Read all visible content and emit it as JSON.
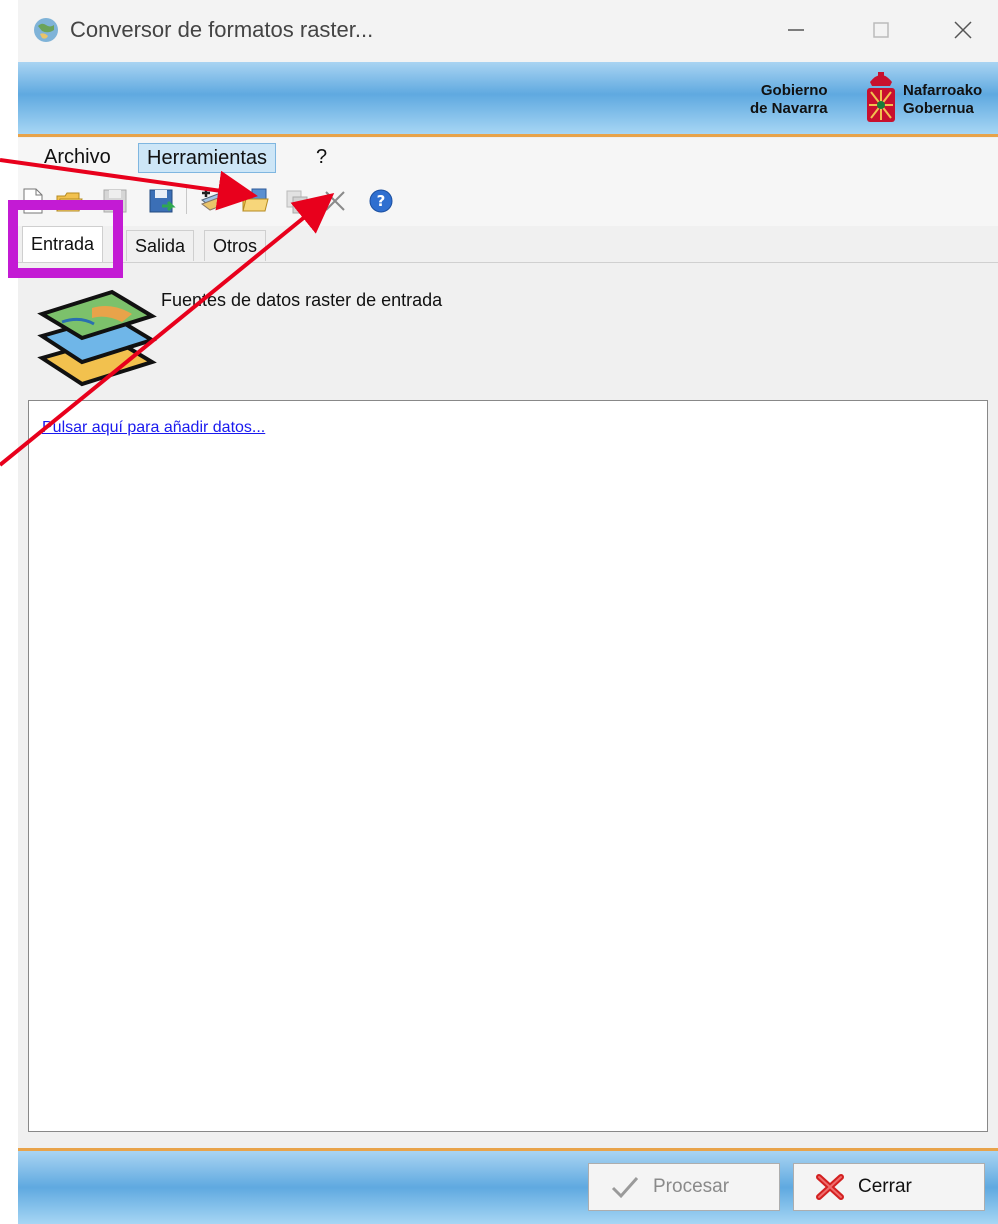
{
  "window": {
    "title": "Conversor de formatos raster...",
    "min_icon": "minimize-icon",
    "max_icon": "maximize-icon",
    "close_icon": "close-icon"
  },
  "banner": {
    "left_text_line1": "Gobierno",
    "left_text_line2": "de Navarra",
    "right_text_line1": "Nafarroako",
    "right_text_line2": "Gobernua",
    "crest_icon": "navarra-crest-icon"
  },
  "menu": {
    "items": [
      "Archivo",
      "Herramientas",
      "?"
    ]
  },
  "toolbar": {
    "icons": [
      "new-document-icon",
      "open-folder-icon",
      "save-disabled-icon",
      "save-as-icon",
      "add-data-icon",
      "open-data-folder-icon",
      "copy-disabled-icon",
      "delete-x-icon",
      "help-icon"
    ]
  },
  "tabs": [
    "Entrada",
    "Salida",
    "Otros"
  ],
  "active_tab": "Entrada",
  "section": {
    "title": "Fuentes de datos raster de entrada",
    "icon": "raster-layers-icon"
  },
  "data_panel": {
    "add_link": "Pulsar aquí para añadir datos..."
  },
  "footer": {
    "procesar_label": "Procesar",
    "cerrar_label": "Cerrar"
  },
  "annotations": {
    "highlight_color": "#c31bd4",
    "arrow_color": "#e8001c"
  }
}
